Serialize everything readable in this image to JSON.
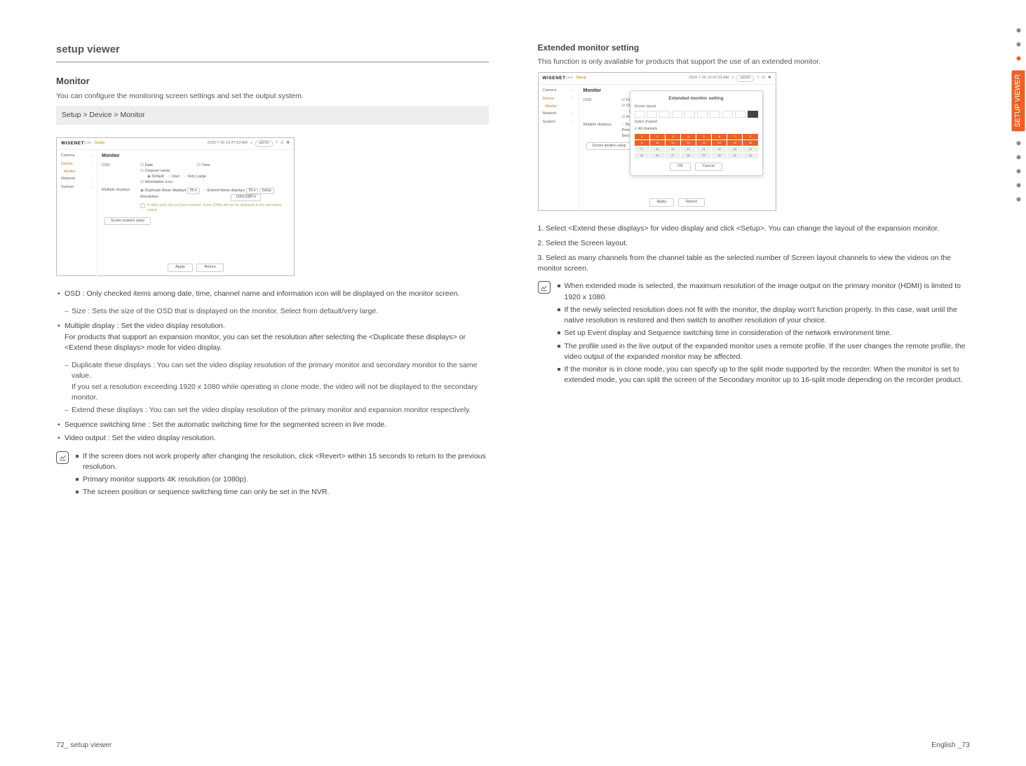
{
  "doc": {
    "section_title": "setup viewer",
    "footer_left": "72_  setup viewer",
    "footer_right": "English _73",
    "sidetab_label": "SETUP VIEWER"
  },
  "monitor": {
    "heading": "Monitor",
    "sub": "You can configure the monitoring screen settings and set the output system.",
    "path": "Setup > Device > Monitor",
    "shot": {
      "brand": "WISENET",
      "setup_crumb": "Setup",
      "live_crumb": "Live",
      "datetime": "2020-7-30 10:47:03 AM",
      "admin": "admin",
      "nav": {
        "camera": "Camera",
        "device": "Device",
        "monitor_sub": "Monitor",
        "network": "Network",
        "system": "System"
      },
      "title": "Monitor",
      "osd_label": "OSD",
      "date": "Date",
      "time": "Time",
      "channel": "Channel name",
      "default": "Default",
      "user": "User",
      "very_large": "Very Large",
      "info": "Information Icon",
      "multi_label": "Multiple displays",
      "dup_primary": "Duplicate these displays",
      "ext_primary": "Extend these displays",
      "resolution": "Resolution",
      "res_val": "1920x1080 ▾",
      "warn": "A video path has not been entered. Some 1080p will not be displayed in the secondary output.",
      "analog_btn": "Screen position setup",
      "apply": "Apply",
      "return": "Return",
      "spinner": "65 ▾"
    },
    "bullets": {
      "osd": "OSD : Only checked items among date, time, channel name and information icon will be displayed on the monitor screen.",
      "osd_sub": "Size : Sets the size of the OSD that is displayed on the monitor. Select from default/very large.",
      "multi": "Multiple display : Set the video display resolution.\nFor products that support an expansion monitor, you can set the resolution after selecting the <Duplicate these displays> or <Extend these displays> mode for video display.",
      "multi_sub1": "Duplicate these displays : You can set the video display resolution of the primary monitor and secondary monitor to the same value.\nIf you set a resolution exceeding 1920 x 1080 while operating in clone mode, the video will not be displayed to the secondary monitor.",
      "multi_sub2": "Extend these displays : You can set the video display resolution of the primary monitor and expansion monitor respectively.",
      "seq": "Sequence switching time : Set the automatic switching time for the segmented screen in live mode.",
      "pb": "Video output : Set the video display resolution.",
      "note1": "If the screen does not work properly after changing the resolution, click <Revert> within 15 seconds to return to the previous resolution.",
      "note2": "Primary monitor supports 4K resolution (or 1080p).",
      "note3": "The screen position or sequence switching time can only be set in the NVR."
    }
  },
  "ext": {
    "heading": "Extended monitor setting",
    "desc": "This function is only available for products that support the use of an extended monitor.",
    "shot": {
      "ext_title": "Extended monitor setting",
      "screen_layout": "Screen layout",
      "select_ch": "Select channel",
      "all": "All channels",
      "ok": "OK",
      "cancel": "Cancel",
      "primary": "Primary monitor",
      "secondary": "Secondary monitor",
      "duplicate": "Duplicate these displays"
    },
    "steps": {
      "s1": "1.  Select <Extend these displays> for video display and click <Setup>. You can change the layout of the expansion monitor.",
      "s2": "2.  Select the Screen layout.",
      "s3": "3.  Select as many channels from the channel table as the selected number of Screen layout channels to view the videos on the monitor screen."
    },
    "notes": {
      "n1": "When extended mode is selected, the maximum resolution of the image output on the primary monitor (HDMI) is limited to 1920 x 1080.",
      "n2": "If the newly selected resolution does not fit with the monitor, the display won't function properly. In this case, wait until the native resolution is restored and then switch to another resolution of your choice.",
      "n3": "Set up Event display and Sequence switching time in consideration of the network environment time.",
      "n4": "The profile used in the live output of the expanded monitor uses a remote profile. If the user changes the remote profile, the video output of the expanded monitor may be affected.",
      "n5": "If the monitor is in clone mode, you can specify up to the split mode supported by the recorder. When the monitor is set to extended mode, you can split the screen of the Secondary monitor up to 16-split mode depending on the recorder product."
    }
  }
}
